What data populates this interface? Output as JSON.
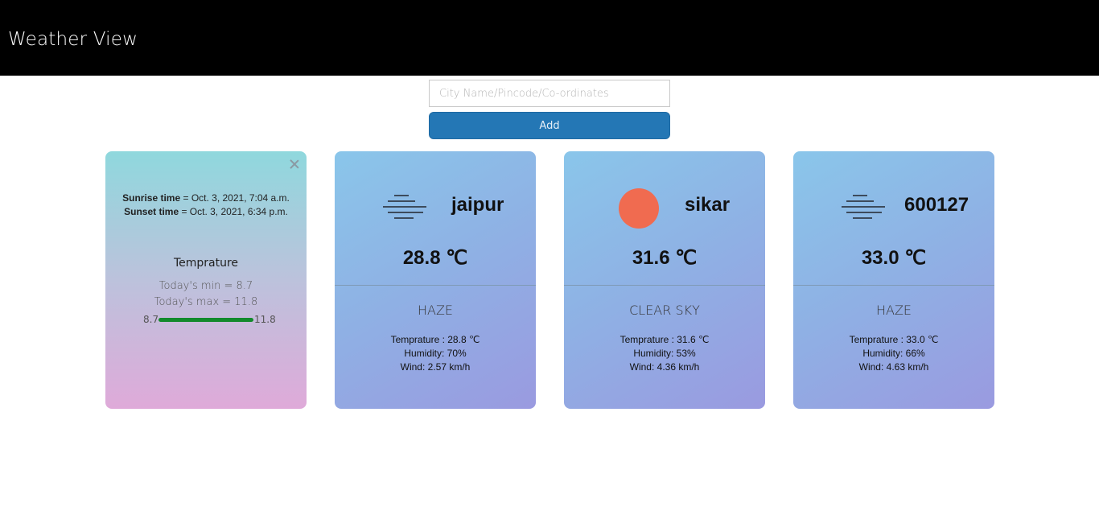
{
  "app": {
    "title": "Weather View"
  },
  "search": {
    "placeholder": "City Name/Pincode/Co-ordinates",
    "value": ""
  },
  "add_button": {
    "label": "Add"
  },
  "details": {
    "sunrise_label": "Sunrise time",
    "sunrise_value": " = Oct. 3, 2021, 7:04 a.m.",
    "sunset_label": "Sunset time",
    "sunset_value": " = Oct. 3, 2021, 6:34 p.m.",
    "temp_heading": "Temprature",
    "min_text": "Today's min = 8.7",
    "max_text": "Today's max = 11.8",
    "range_min": "8.7",
    "range_max": "11.8",
    "range_fill_fraction": 1.0
  },
  "cards": [
    {
      "city": "jaipur",
      "icon": "haze-icon",
      "temp": "28.8 ℃",
      "condition": "HAZE",
      "temp_line": "Temprature : 28.8 ℃",
      "humidity_line": "Humidity: 70%",
      "wind_line": "Wind: 2.57 km/h"
    },
    {
      "city": "sikar",
      "icon": "sun-icon",
      "temp": "31.6 ℃",
      "condition": "CLEAR SKY",
      "temp_line": "Temprature : 31.6 ℃",
      "humidity_line": "Humidity: 53%",
      "wind_line": "Wind: 4.36 km/h"
    },
    {
      "city": "600127",
      "icon": "haze-icon",
      "temp": "33.0 ℃",
      "condition": "HAZE",
      "temp_line": "Temprature : 33.0 ℃",
      "humidity_line": "Humidity: 66%",
      "wind_line": "Wind: 4.63 km/h"
    }
  ],
  "colors": {
    "navbar": "#000000",
    "button": "#2477b5",
    "sun": "#f06b50",
    "range_fill": "#128a2c"
  }
}
